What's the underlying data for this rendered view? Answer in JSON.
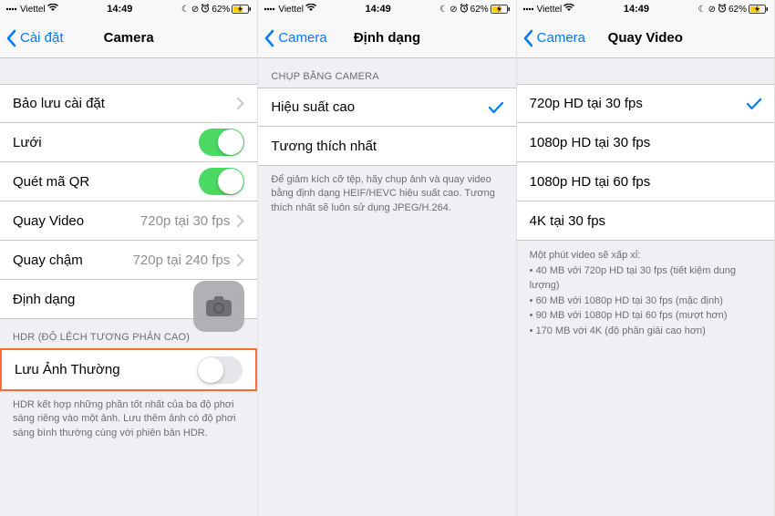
{
  "status": {
    "carrier": "Viettel",
    "time": "14:49",
    "battery_pct": "62%",
    "moon": "☾",
    "lock": "⊘",
    "alarm": "⏰"
  },
  "screen1": {
    "back": "Cài đặt",
    "title": "Camera",
    "rows": {
      "preserve": "Bảo lưu cài đặt",
      "grid": "Lưới",
      "qr": "Quét mã QR",
      "recvideo": "Quay Video",
      "recvideo_detail": "720p tại 30 fps",
      "slomo": "Quay chậm",
      "slomo_detail": "720p tại 240 fps",
      "formats": "Định dạng"
    },
    "hdr_header": "HDR (ĐỘ LỆCH TƯƠNG PHẢN CAO)",
    "keepnormal": "Lưu Ảnh Thường",
    "hdr_footer": "HDR kết hợp những phần tốt nhất của ba độ phơi sáng riêng vào một ảnh. Lưu thêm ảnh có độ phơi sáng bình thường cùng với phiên bản HDR."
  },
  "screen2": {
    "back": "Camera",
    "title": "Định dạng",
    "section": "CHỤP BẰNG CAMERA",
    "high_eff": "Hiệu suất cao",
    "most_compat": "Tương thích nhất",
    "footer": "Để giảm kích cỡ tệp, hãy chụp ảnh và quay video bằng định dạng HEIF/HEVC hiệu suất cao. Tương thích nhất sẽ luôn sử dụng JPEG/H.264."
  },
  "screen3": {
    "back": "Camera",
    "title": "Quay Video",
    "opts": {
      "720_30": "720p HD tại 30 fps",
      "1080_30": "1080p HD tại 30 fps",
      "1080_60": "1080p HD tại 60 fps",
      "4k_30": "4K tại 30 fps"
    },
    "footer_title": "Một phút video sẽ xấp xỉ:",
    "bullets": {
      "b1": "• 40 MB với 720p HD tại 30 fps (tiết kiệm dung lượng)",
      "b2": "• 60 MB với 1080p HD tại 30 fps (mặc định)",
      "b3": "• 90 MB với 1080p HD tại 60 fps (mượt hơn)",
      "b4": "• 170 MB với 4K (độ phân giải cao hơn)"
    }
  }
}
